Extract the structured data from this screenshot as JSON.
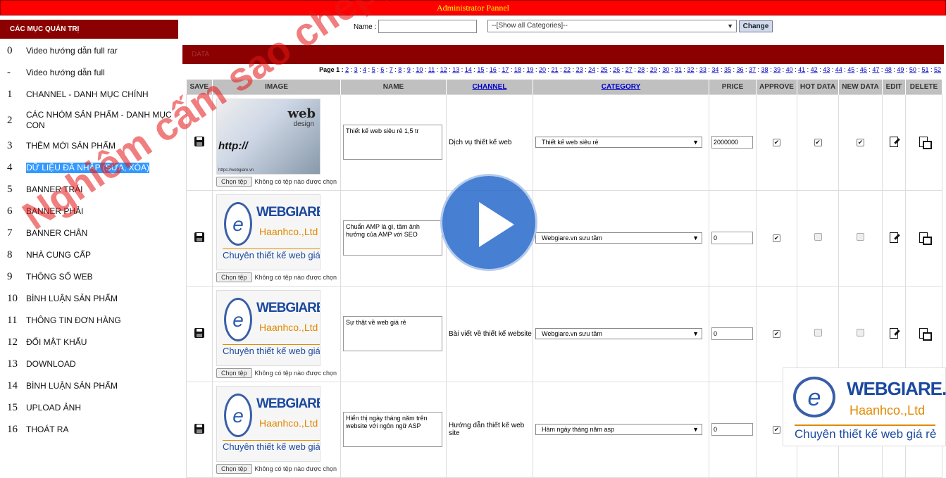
{
  "header": {
    "title": "Administrator Pannel"
  },
  "sidebar": {
    "title": "CÁC MỤC QUẢN TRỊ",
    "items": [
      {
        "num": "0",
        "label": "Video hướng dẫn full rar"
      },
      {
        "num": "-",
        "label": "Video hướng dẫn full"
      },
      {
        "num": "1",
        "label": "CHANNEL - DANH MỤC CHÍNH"
      },
      {
        "num": "2",
        "label": "CÁC NHÓM SẢN PHẨM - DANH MỤC CON"
      },
      {
        "num": "3",
        "label": "THÊM MỚI SẢN PHẨM"
      },
      {
        "num": "4",
        "label": "DỮ LIỆU ĐÃ NHẬP (SỬA, XÓA)"
      },
      {
        "num": "5",
        "label": "BANNER TRÁI"
      },
      {
        "num": "6",
        "label": "BANNER PHẢI"
      },
      {
        "num": "7",
        "label": "BANNER CHÂN"
      },
      {
        "num": "8",
        "label": "NHÀ CUNG CẤP"
      },
      {
        "num": "9",
        "label": "THÔNG SỐ WEB"
      },
      {
        "num": "10",
        "label": "BÌNH LUẬN SẢN PHẨM"
      },
      {
        "num": "11",
        "label": "THÔNG TIN ĐƠN HÀNG"
      },
      {
        "num": "12",
        "label": "ĐỔI MẬT KHẨU"
      },
      {
        "num": "13",
        "label": "DOWNLOAD"
      },
      {
        "num": "14",
        "label": "BÌNH LUẬN SẢN PHẨM"
      },
      {
        "num": "15",
        "label": "UPLOAD ẢNH"
      },
      {
        "num": "16",
        "label": "THOÁT RA"
      }
    ]
  },
  "filter": {
    "name_label": "Name :",
    "name_value": "",
    "category_selected": "--[Show all Categories]--",
    "change_label": "Change"
  },
  "panel": {
    "title": "DATA"
  },
  "pager": {
    "label": "Page 1 :",
    "pages": [
      "2",
      "3",
      "4",
      "5",
      "6",
      "7",
      "8",
      "9",
      "10",
      "11",
      "12",
      "13",
      "14",
      "15",
      "16",
      "17",
      "18",
      "19",
      "20",
      "21",
      "22",
      "23",
      "24",
      "25",
      "26",
      "27",
      "28",
      "29",
      "30",
      "31",
      "32",
      "33",
      "34",
      "35",
      "36",
      "37",
      "38",
      "39",
      "40",
      "41",
      "42",
      "43",
      "44",
      "45",
      "46",
      "47",
      "48",
      "49",
      "50",
      "51",
      "52"
    ]
  },
  "table": {
    "headers": {
      "save": "SAVE",
      "image": "IMAGE",
      "name": "NAME",
      "channel": "CHANNEL",
      "category": "CATEGORY",
      "price": "PRICE",
      "approve": "APPROVE",
      "hot": "HOT DATA",
      "new": "NEW DATA",
      "edit": "EDIT",
      "delete": "DELETE"
    },
    "file_button": "Chọn tệp",
    "file_none": "Không có tệp nào được chọn",
    "rows": [
      {
        "image": "web-design",
        "name": "Thiết kế web siêu rẻ 1,5 tr",
        "channel": "Dịch vụ thiết kế web",
        "category": "Thiết kế web siêu rẻ",
        "price": "2000000",
        "approve": true,
        "hot": true,
        "new": true
      },
      {
        "image": "webgiare",
        "name": "Chuẩn AMP là gì, tầm ảnh hưởng của AMP với SEO",
        "channel": "",
        "category": "Webgiare.vn sưu tầm",
        "price": "0",
        "approve": true,
        "hot": false,
        "new": false
      },
      {
        "image": "webgiare",
        "name": "Sự thật về web giá rẻ",
        "channel": "Bài viết về thiết kế website",
        "category": "Webgiare.vn sưu tầm",
        "price": "0",
        "approve": true,
        "hot": false,
        "new": false
      },
      {
        "image": "webgiare",
        "name": "Hiển thị ngày tháng năm trên website với ngôn ngữ ASP",
        "channel": "Hướng dẫn thiết kế web site",
        "category": "Hàm ngày tháng năm asp",
        "price": "0",
        "approve": true,
        "hot": false,
        "new": false
      }
    ]
  },
  "thumb_web": {
    "word": "web",
    "design": "design",
    "http": "http://",
    "url": "https://webgiare.vn"
  },
  "brand": {
    "mark": "e",
    "name": "WEBGIARE.VN",
    "company": "Haanhco.,Ltd",
    "slogan": "Chuyên thiết kế web giá rẻ"
  },
  "watermark": "Nghiêm cấm sao chép, share link dưới mọi hình thức"
}
